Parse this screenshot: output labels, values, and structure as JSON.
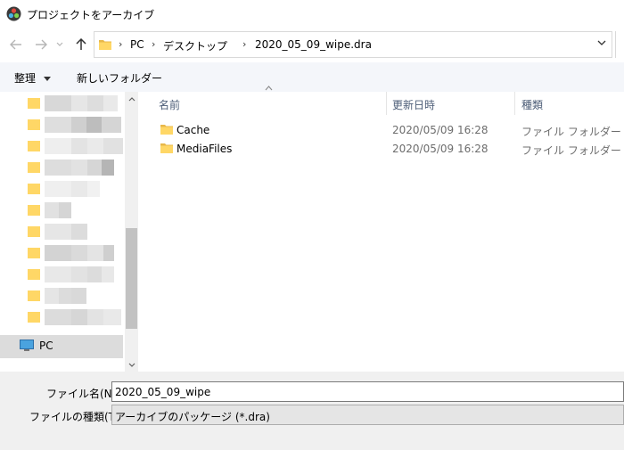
{
  "window": {
    "title": "プロジェクトをアーカイブ"
  },
  "nav": {
    "breadcrumbs": [
      "PC",
      "デスクトップ",
      "2020_05_09_wipe.dra"
    ]
  },
  "toolbar": {
    "organize_label": "整理",
    "new_folder_label": "新しいフォルダー"
  },
  "sidebar": {
    "pc_label": "PC"
  },
  "columns": {
    "name": "名前",
    "modified": "更新日時",
    "type": "種類"
  },
  "files": [
    {
      "name": "Cache",
      "modified": "2020/05/09 16:28",
      "type": "ファイル フォルダー"
    },
    {
      "name": "MediaFiles",
      "modified": "2020/05/09 16:28",
      "type": "ファイル フォルダー"
    }
  ],
  "form": {
    "filename_label": "ファイル名(N):",
    "filename_value": "2020_05_09_wipe",
    "filetype_label": "ファイルの種類(T):",
    "filetype_value": "アーカイブのパッケージ (*.dra)"
  },
  "colors": {
    "folder": "#ffd766",
    "folder_dark": "#e8b84a",
    "toolbar_bg": "#f4f6fa",
    "selected_bg": "#dcdcdc",
    "column_header_text": "#4c5d77"
  }
}
